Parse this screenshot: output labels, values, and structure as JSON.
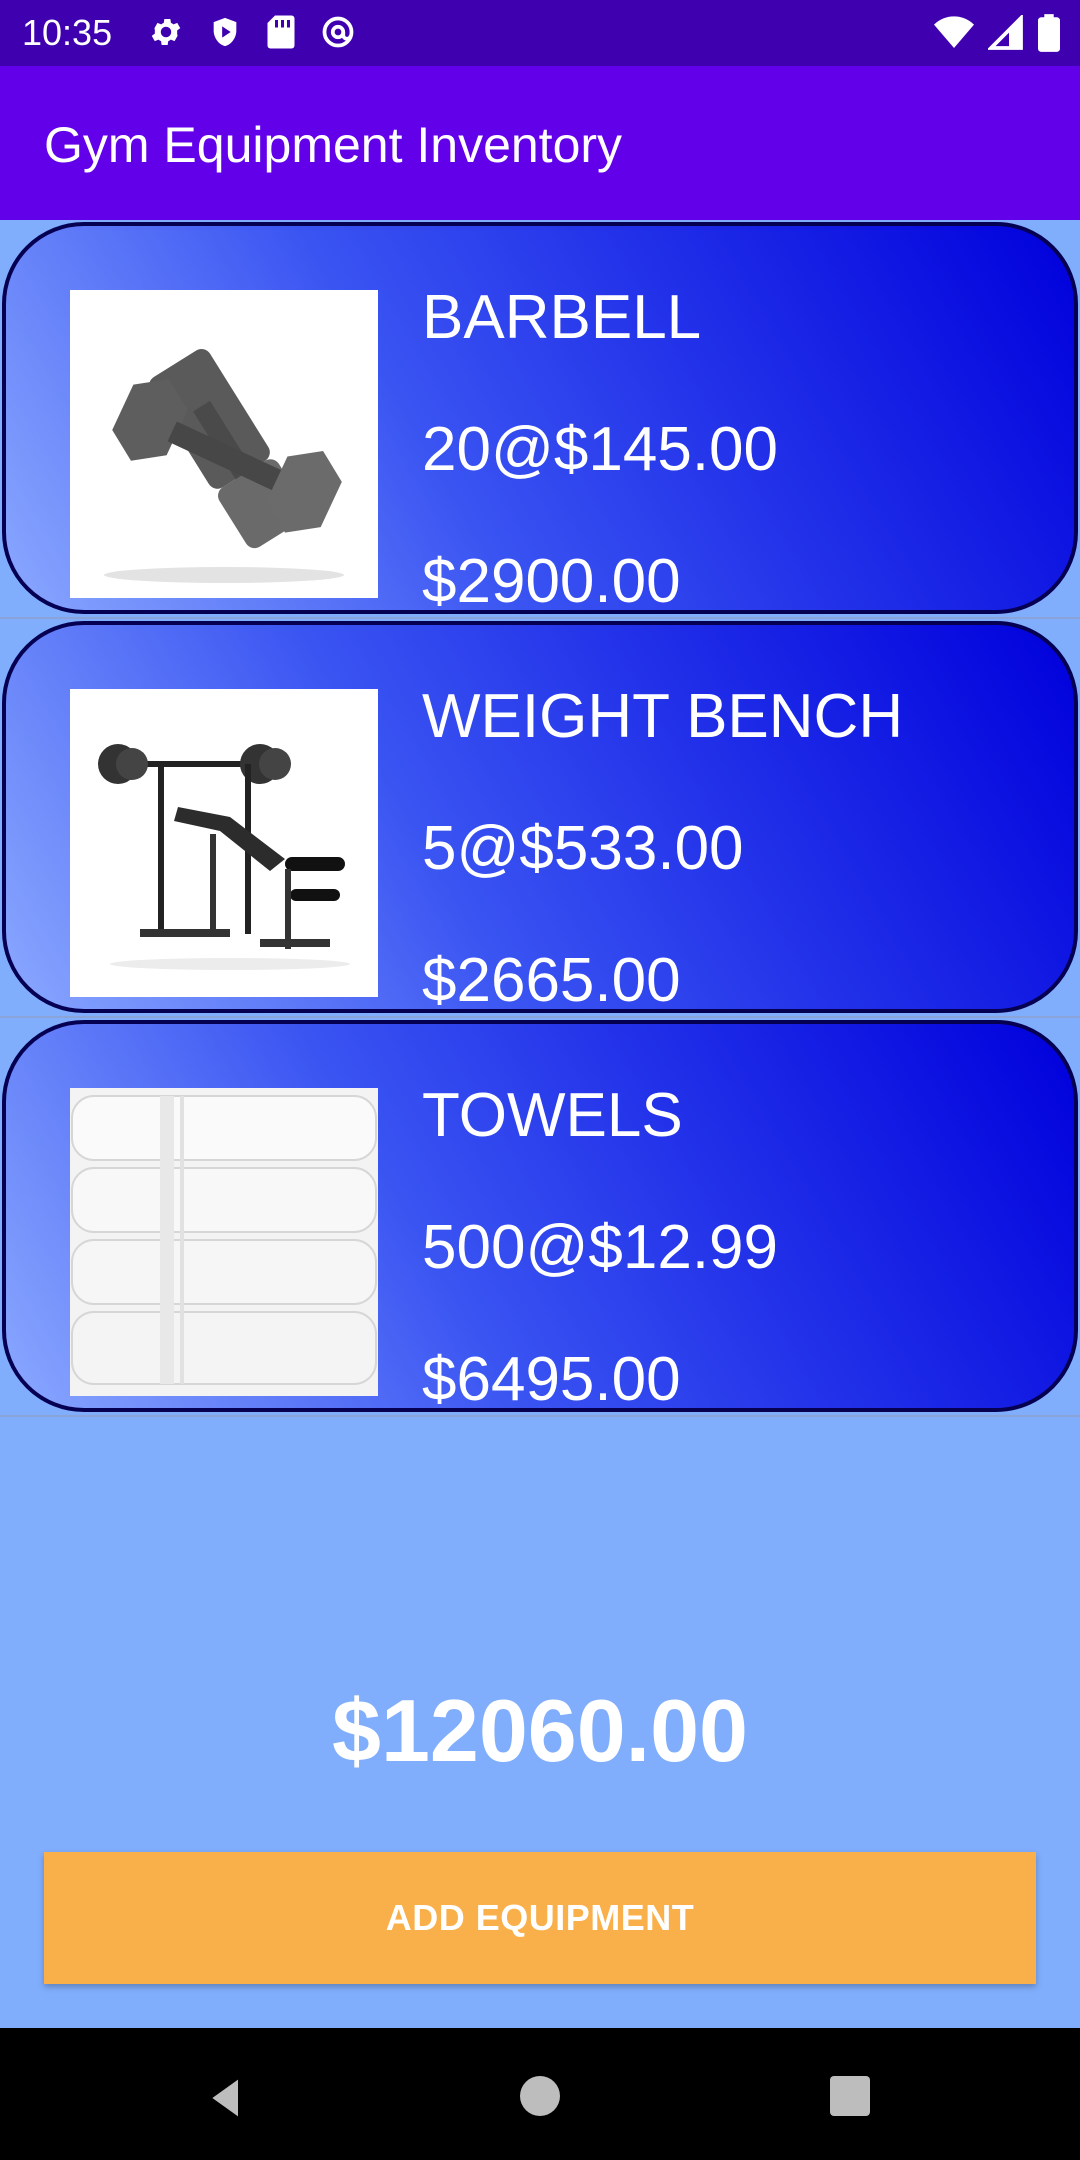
{
  "status_bar": {
    "time": "10:35",
    "left_icons": [
      "gear-icon",
      "play-protect-icon",
      "sd-card-icon",
      "at-sign-icon"
    ],
    "right_icons": [
      "wifi-icon",
      "signal-icon",
      "battery-icon"
    ]
  },
  "app_bar": {
    "title": "Gym Equipment Inventory"
  },
  "items": [
    {
      "name": "BARBELL",
      "qty_price": "20@$145.00",
      "total": "$2900.00",
      "image": "dumbbells-image"
    },
    {
      "name": "WEIGHT BENCH",
      "qty_price": "5@$533.00",
      "total": "$2665.00",
      "image": "weight-bench-image"
    },
    {
      "name": "TOWELS",
      "qty_price": "500@$12.99",
      "total": "$6495.00",
      "image": "towels-image"
    }
  ],
  "grand_total": "$12060.00",
  "add_button": {
    "label": "ADD EQUIPMENT"
  },
  "colors": {
    "status_bar": "#3f00b0",
    "app_bar": "#6200ea",
    "background": "#80aefc",
    "button": "#f9b04a",
    "card_gradient_end": "#0000dc"
  },
  "nav_bar": {
    "icons": [
      "back-icon",
      "home-icon",
      "recents-icon"
    ]
  }
}
